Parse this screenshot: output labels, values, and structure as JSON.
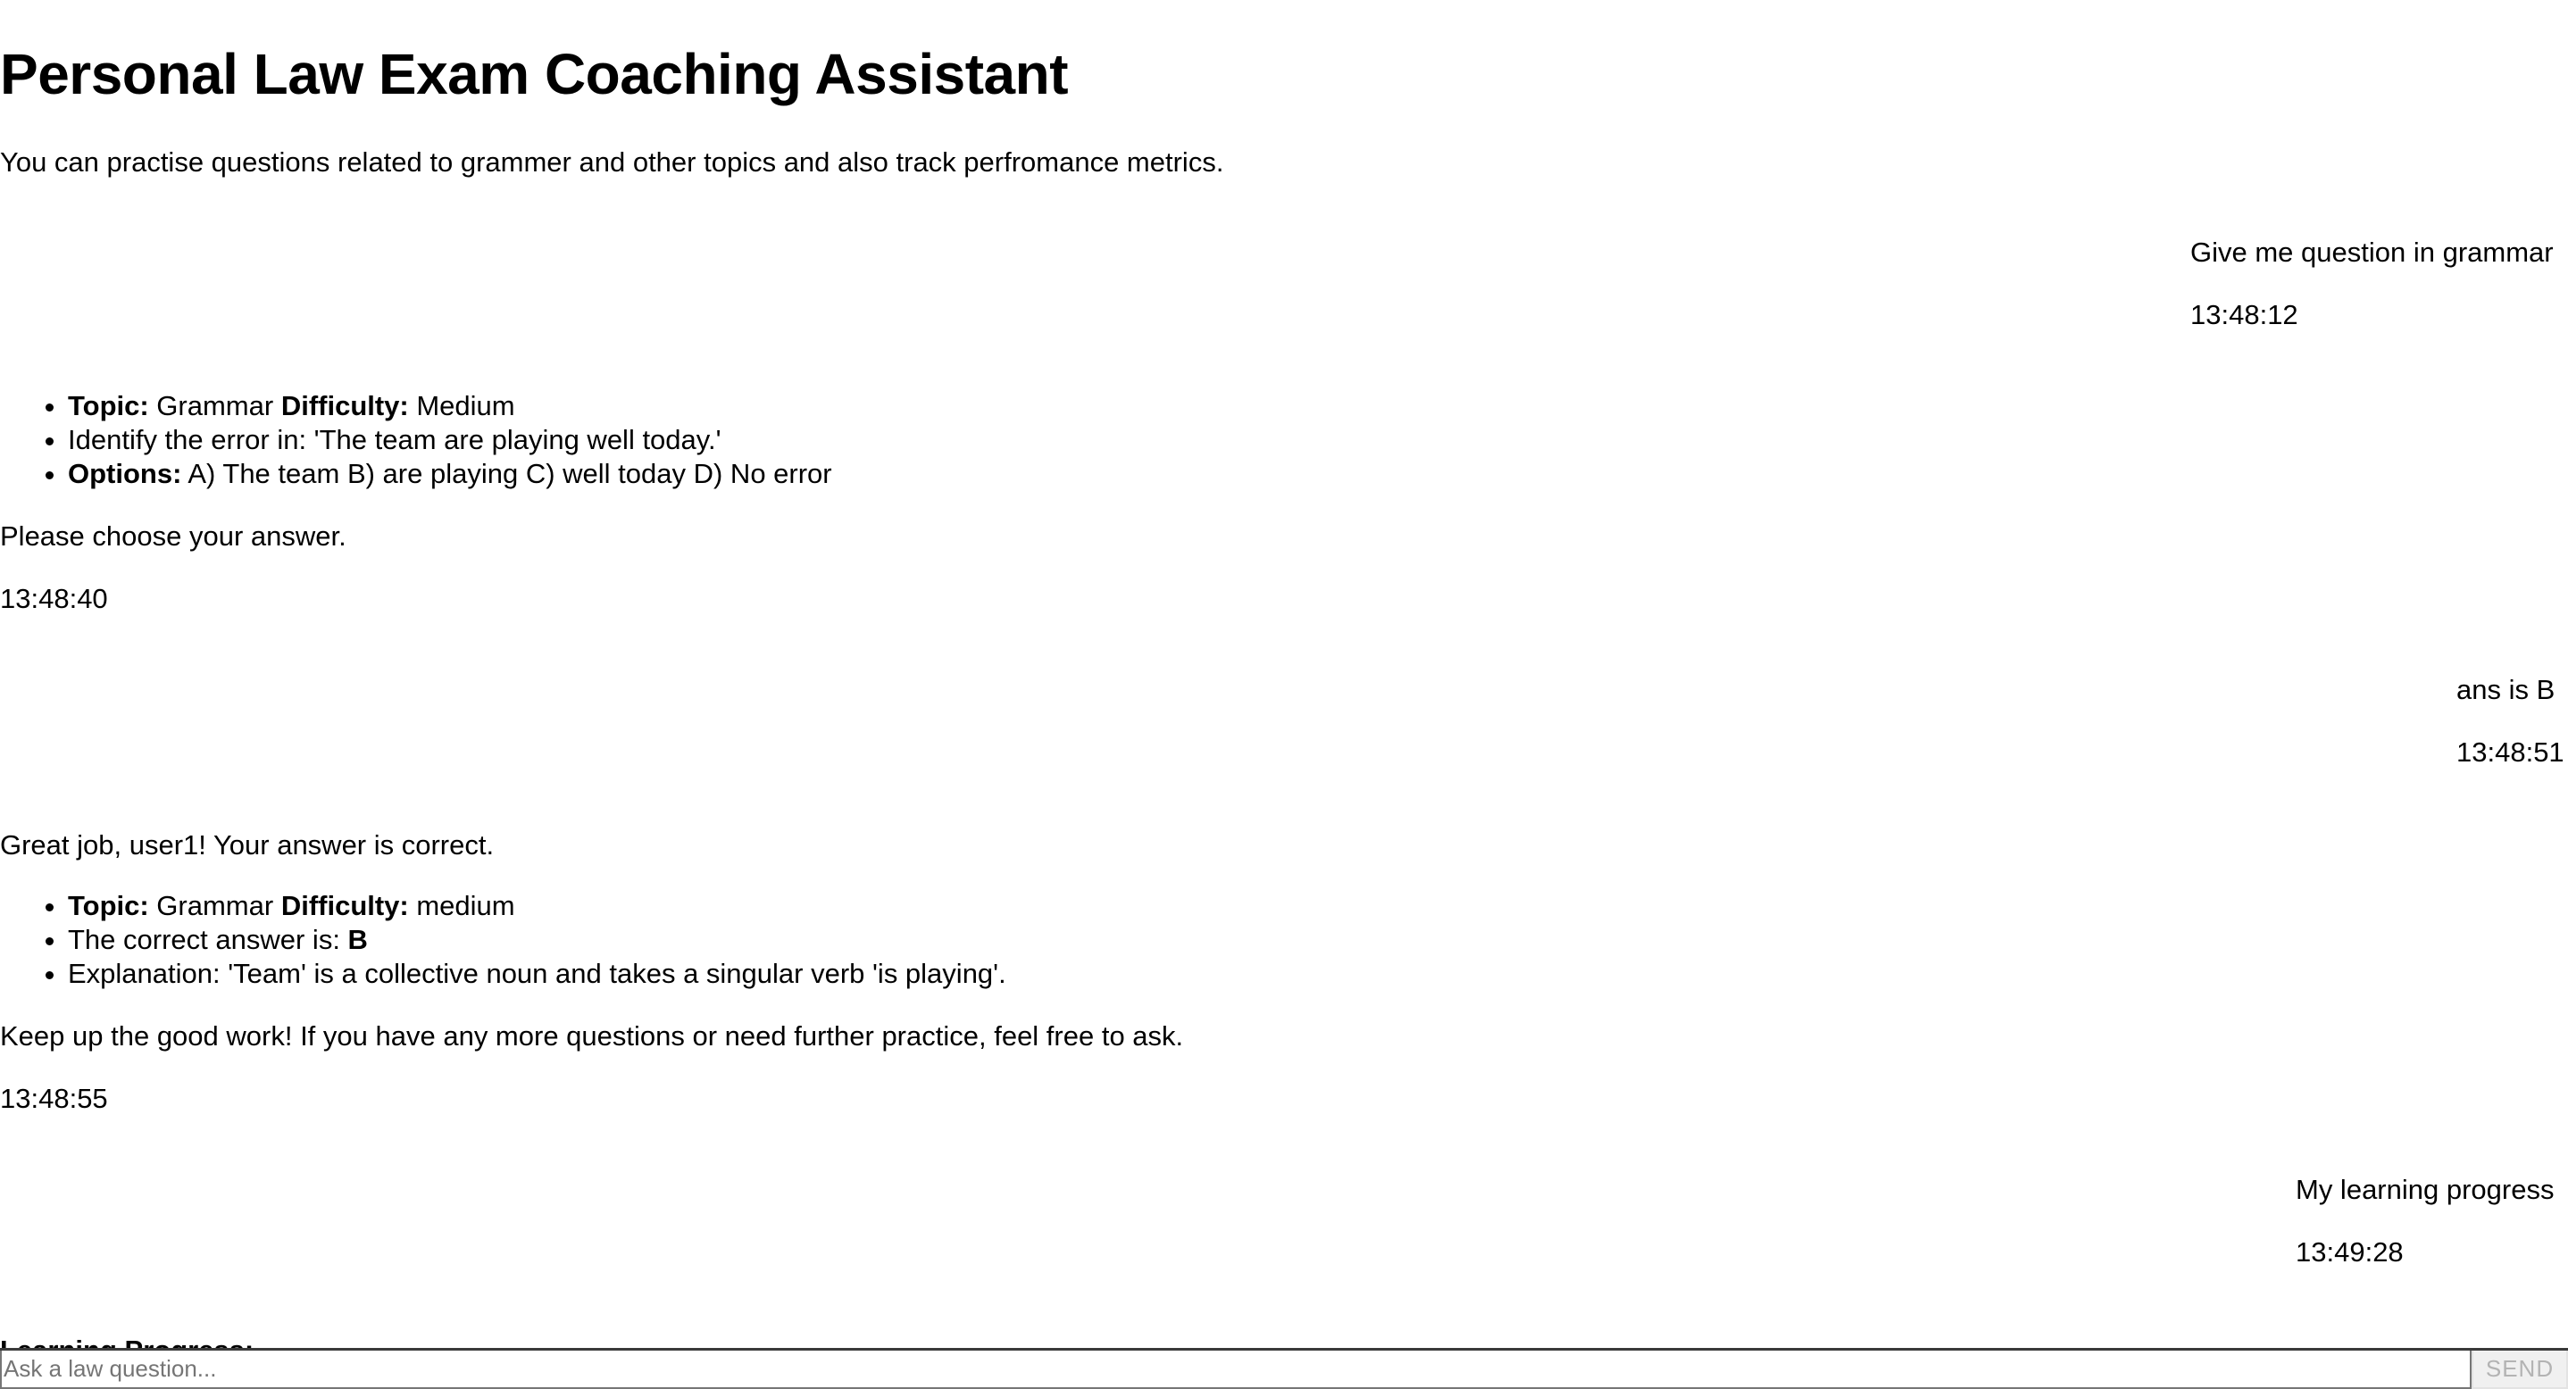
{
  "header": {
    "title": "Personal Law Exam Coaching Assistant",
    "subtitle": "You can practise questions related to grammer and other topics and also track perfromance metrics."
  },
  "messages": {
    "user_1": {
      "text": "Give me question in grammar",
      "time": "13:48:12"
    },
    "bot_1": {
      "items": {
        "topic_label": "Topic:",
        "topic_value": " Grammar ",
        "difficulty_label": "Difficulty:",
        "difficulty_value": " Medium",
        "question": "Identify the error in: 'The team are playing well today.'",
        "options_label": "Options:",
        "options_value": " A) The team B) are playing C) well today D) No error"
      },
      "after": "Please choose your answer.",
      "time": "13:48:40"
    },
    "user_2": {
      "text": "ans is B",
      "time": "13:48:51"
    },
    "bot_2": {
      "before": "Great job, user1! Your answer is correct.",
      "items": {
        "topic_label": "Topic:",
        "topic_value": " Grammar ",
        "difficulty_label": "Difficulty:",
        "difficulty_value": " medium",
        "answer_text": "The correct answer is: ",
        "answer_value": "B",
        "explanation": "Explanation: 'Team' is a collective noun and takes a singular verb 'is playing'."
      },
      "after": "Keep up the good work! If you have any more questions or need further practice, feel free to ask.",
      "time": "13:48:55"
    },
    "user_3": {
      "text": "My learning progress",
      "time": "13:49:28"
    },
    "bot_3": {
      "heading": "Learning Progress:"
    }
  },
  "composer": {
    "placeholder": "Ask a law question...",
    "value": "",
    "send_label": "SEND"
  }
}
